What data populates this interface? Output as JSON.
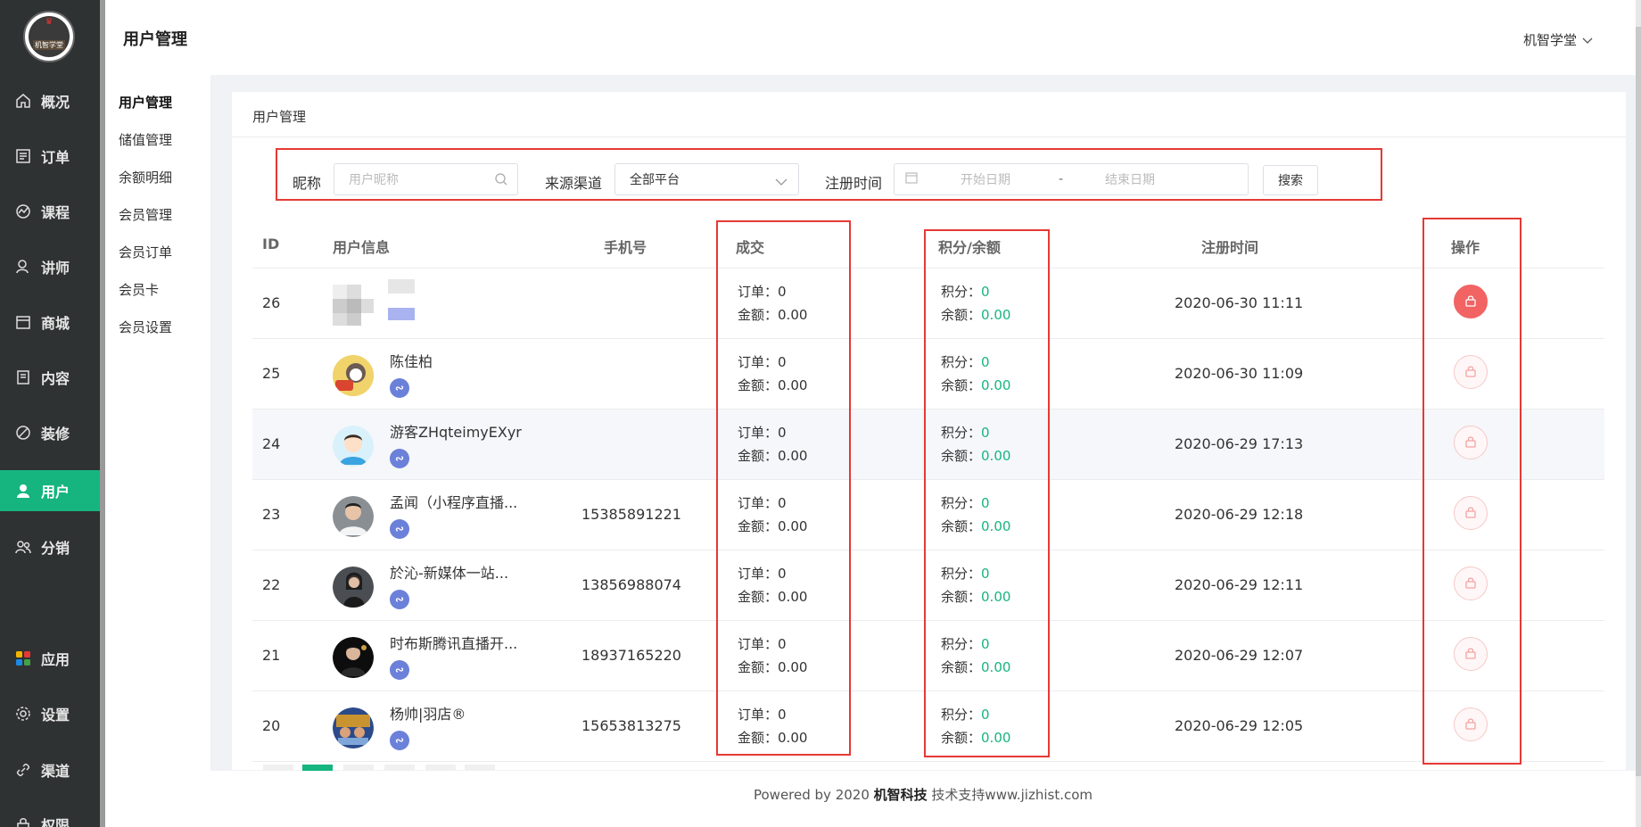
{
  "sidebar": {
    "logo_text": "机智学堂",
    "items": [
      {
        "label": "概况",
        "icon": "home-icon"
      },
      {
        "label": "订单",
        "icon": "order-icon"
      },
      {
        "label": "课程",
        "icon": "course-icon"
      },
      {
        "label": "讲师",
        "icon": "teacher-icon"
      },
      {
        "label": "商城",
        "icon": "store-icon"
      },
      {
        "label": "内容",
        "icon": "content-icon"
      },
      {
        "label": "装修",
        "icon": "decorate-icon"
      },
      {
        "label": "用户",
        "icon": "user-icon"
      },
      {
        "label": "分销",
        "icon": "distribution-icon"
      },
      {
        "label": "应用",
        "icon": "apps-icon"
      },
      {
        "label": "设置",
        "icon": "settings-icon"
      },
      {
        "label": "渠道",
        "icon": "channel-icon"
      },
      {
        "label": "权限",
        "icon": "permission-icon"
      }
    ],
    "active_index": 7
  },
  "header": {
    "title": "用户管理",
    "user_name": "机智学堂"
  },
  "subnav": {
    "items": [
      "用户管理",
      "储值管理",
      "余额明细",
      "会员管理",
      "会员订单",
      "会员卡",
      "会员设置"
    ]
  },
  "card": {
    "title": "用户管理"
  },
  "filter": {
    "nickname_label": "昵称",
    "nickname_placeholder": "用户昵称",
    "source_label": "来源渠道",
    "source_value": "全部平台",
    "reg_label": "注册时间",
    "start_placeholder": "开始日期",
    "range_sep": "-",
    "end_placeholder": "结束日期",
    "search_label": "搜索"
  },
  "table": {
    "columns": [
      "ID",
      "用户信息",
      "手机号",
      "成交",
      "积分/余额",
      "注册时间",
      "操作"
    ],
    "order_label": "订单：",
    "amount_label": "金额：",
    "points_label": "积分：",
    "balance_label": "余额：",
    "rows": [
      {
        "id": "26",
        "name": "",
        "phone": "",
        "orders": "0",
        "amount": "0.00",
        "points": "0",
        "balance": "0.00",
        "reg_time": "2020-06-30 11:11",
        "locked": true
      },
      {
        "id": "25",
        "name": "陈佳柏",
        "phone": "",
        "orders": "0",
        "amount": "0.00",
        "points": "0",
        "balance": "0.00",
        "reg_time": "2020-06-30 11:09",
        "locked": false
      },
      {
        "id": "24",
        "name": "游客ZHqteimyEXyr",
        "phone": "",
        "orders": "0",
        "amount": "0.00",
        "points": "0",
        "balance": "0.00",
        "reg_time": "2020-06-29 17:13",
        "locked": false
      },
      {
        "id": "23",
        "name": "孟闻（小程序直播...",
        "phone": "15385891221",
        "orders": "0",
        "amount": "0.00",
        "points": "0",
        "balance": "0.00",
        "reg_time": "2020-06-29 12:18",
        "locked": false
      },
      {
        "id": "22",
        "name": "於沁-新媒体一站...",
        "phone": "13856988074",
        "orders": "0",
        "amount": "0.00",
        "points": "0",
        "balance": "0.00",
        "reg_time": "2020-06-29 12:11",
        "locked": false
      },
      {
        "id": "21",
        "name": "时布斯腾讯直播开...",
        "phone": "18937165220",
        "orders": "0",
        "amount": "0.00",
        "points": "0",
        "balance": "0.00",
        "reg_time": "2020-06-29 12:07",
        "locked": false
      },
      {
        "id": "20",
        "name": "杨帅|羽店®",
        "phone": "15653813275",
        "orders": "0",
        "amount": "0.00",
        "points": "0",
        "balance": "0.00",
        "reg_time": "2020-06-29 12:05",
        "locked": false
      }
    ]
  },
  "footer": {
    "prefix": "Powered by 2020 ",
    "brand": "机智科技",
    "suffix": " 技术支持www.jizhist.com"
  },
  "colors": {
    "accent": "#16b57f",
    "sidebar_bg": "#2f3233",
    "highlight_red": "#e53935",
    "lock_red": "#f26363"
  }
}
